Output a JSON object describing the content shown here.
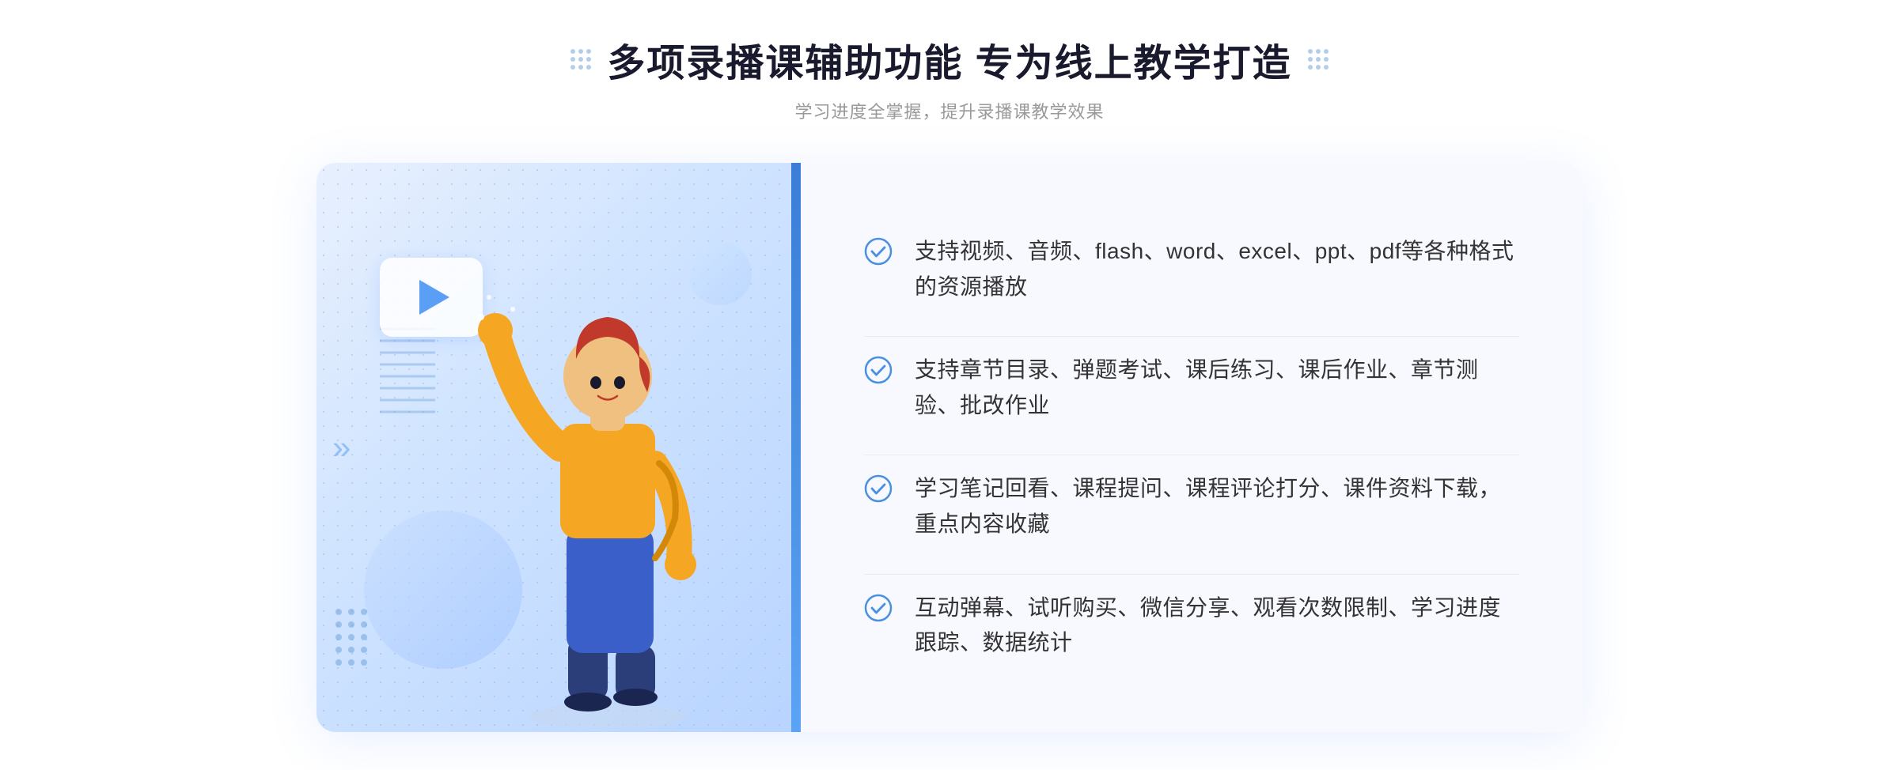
{
  "header": {
    "main_title": "多项录播课辅助功能 专为线上教学打造",
    "subtitle": "学习进度全掌握，提升录播课教学效果"
  },
  "features": [
    {
      "id": 1,
      "text": "支持视频、音频、flash、word、excel、ppt、pdf等各种格式的资源播放"
    },
    {
      "id": 2,
      "text": "支持章节目录、弹题考试、课后练习、课后作业、章节测验、批改作业"
    },
    {
      "id": 3,
      "text": "学习笔记回看、课程提问、课程评论打分、课件资料下载，重点内容收藏"
    },
    {
      "id": 4,
      "text": "互动弹幕、试听购买、微信分享、观看次数限制、学习进度跟踪、数据统计"
    }
  ],
  "illustration": {
    "play_button_alt": "播放按钮",
    "person_alt": "指向上方的人物插图"
  },
  "colors": {
    "accent": "#4a90e2",
    "accent_light": "#e8f0fe",
    "text_dark": "#1a1a2e",
    "text_gray": "#999999",
    "text_feature": "#333333",
    "check_color": "#4a90e2",
    "bg_light": "#f8f9ff"
  }
}
